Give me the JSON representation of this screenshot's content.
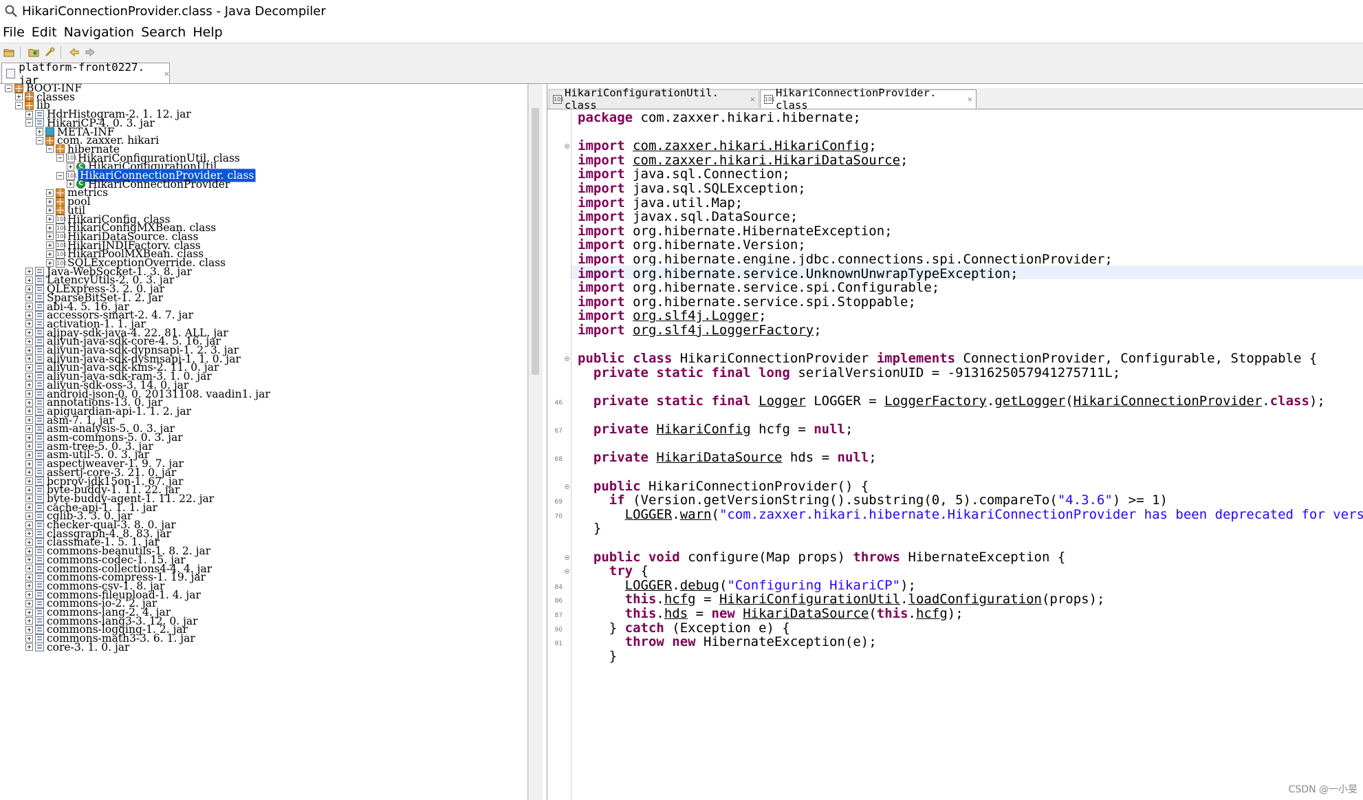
{
  "window": {
    "title": "HikariConnectionProvider.class - Java Decompiler"
  },
  "menu": [
    "File",
    "Edit",
    "Navigation",
    "Search",
    "Help"
  ],
  "toolbar": {
    "icons": [
      "open-folder-icon",
      "open-type-icon",
      "search-icon",
      "back-arrow-icon",
      "forward-arrow-icon"
    ]
  },
  "outer_tab": {
    "label": "platform-front0227. jar"
  },
  "tree": [
    {
      "label": "BOOT-INF",
      "icon": "pkg",
      "exp": "minus",
      "level": 0
    },
    {
      "label": "classes",
      "icon": "pkg",
      "exp": "plus",
      "level": 1
    },
    {
      "label": "lib",
      "icon": "pkg",
      "exp": "minus",
      "level": 1
    },
    {
      "label": "HdrHistogram-2. 1. 12. jar",
      "icon": "jar",
      "exp": "plus",
      "level": 2
    },
    {
      "label": "HikariCP-4. 0. 3. jar",
      "icon": "jar",
      "exp": "minus",
      "level": 2
    },
    {
      "label": "META-INF",
      "icon": "meta",
      "exp": "plus",
      "level": 3
    },
    {
      "label": "com. zaxxer. hikari",
      "icon": "pkg",
      "exp": "minus",
      "level": 3
    },
    {
      "label": "hibernate",
      "icon": "pkg",
      "exp": "minus",
      "level": 4
    },
    {
      "label": "HikariConfigurationUtil. class",
      "icon": "cls",
      "exp": "minus",
      "level": 5
    },
    {
      "label": "HikariConfigurationUtil",
      "icon": "tcls",
      "exp": "plus",
      "level": 6
    },
    {
      "label": "HikariConnectionProvider. class",
      "icon": "cls",
      "exp": "minus",
      "level": 5,
      "selected": true
    },
    {
      "label": "HikariConnectionProvider",
      "icon": "tcls",
      "exp": "plus",
      "level": 6
    },
    {
      "label": "metrics",
      "icon": "pkg",
      "exp": "plus",
      "level": 4
    },
    {
      "label": "pool",
      "icon": "pkg",
      "exp": "plus",
      "level": 4
    },
    {
      "label": "util",
      "icon": "pkg",
      "exp": "plus",
      "level": 4
    },
    {
      "label": "HikariConfig. class",
      "icon": "cls",
      "exp": "plus",
      "level": 4
    },
    {
      "label": "HikariConfigMXBean. class",
      "icon": "cls",
      "exp": "plus",
      "level": 4
    },
    {
      "label": "HikariDataSource. class",
      "icon": "cls",
      "exp": "plus",
      "level": 4
    },
    {
      "label": "HikariJNDIFactory. class",
      "icon": "cls",
      "exp": "plus",
      "level": 4
    },
    {
      "label": "HikariPoolMXBean. class",
      "icon": "cls",
      "exp": "plus",
      "level": 4
    },
    {
      "label": "SQLExceptionOverride. class",
      "icon": "cls",
      "exp": "plus",
      "level": 4
    },
    {
      "label": "Java-WebSocket-1. 3. 8. jar",
      "icon": "jar",
      "exp": "plus",
      "level": 2
    },
    {
      "label": "LatencyUtils-2. 0. 3. jar",
      "icon": "jar",
      "exp": "plus",
      "level": 2
    },
    {
      "label": "QLExpress-3. 2. 0. jar",
      "icon": "jar",
      "exp": "plus",
      "level": 2
    },
    {
      "label": "SparseBitSet-1. 2. jar",
      "icon": "jar",
      "exp": "plus",
      "level": 2
    },
    {
      "label": "abi-4. 5. 16. jar",
      "icon": "jar",
      "exp": "plus",
      "level": 2
    },
    {
      "label": "accessors-smart-2. 4. 7. jar",
      "icon": "jar",
      "exp": "plus",
      "level": 2
    },
    {
      "label": "activation-1. 1. jar",
      "icon": "jar",
      "exp": "plus",
      "level": 2
    },
    {
      "label": "alipay-sdk-java-4. 22. 81. ALL. jar",
      "icon": "jar",
      "exp": "plus",
      "level": 2
    },
    {
      "label": "aliyun-java-sdk-core-4. 5. 16. jar",
      "icon": "jar",
      "exp": "plus",
      "level": 2
    },
    {
      "label": "aliyun-java-sdk-dypnsapi-1. 2. 3. jar",
      "icon": "jar",
      "exp": "plus",
      "level": 2
    },
    {
      "label": "aliyun-java-sdk-dysmsapi-1. 1. 0. jar",
      "icon": "jar",
      "exp": "plus",
      "level": 2
    },
    {
      "label": "aliyun-java-sdk-kms-2. 11. 0. jar",
      "icon": "jar",
      "exp": "plus",
      "level": 2
    },
    {
      "label": "aliyun-java-sdk-ram-3. 1. 0. jar",
      "icon": "jar",
      "exp": "plus",
      "level": 2
    },
    {
      "label": "aliyun-sdk-oss-3. 14. 0. jar",
      "icon": "jar",
      "exp": "plus",
      "level": 2
    },
    {
      "label": "android-json-0. 0. 20131108. vaadin1. jar",
      "icon": "jar",
      "exp": "plus",
      "level": 2
    },
    {
      "label": "annotations-13. 0. jar",
      "icon": "jar",
      "exp": "plus",
      "level": 2
    },
    {
      "label": "apiguardian-api-1. 1. 2. jar",
      "icon": "jar",
      "exp": "plus",
      "level": 2
    },
    {
      "label": "asm-7. 1. jar",
      "icon": "jar",
      "exp": "plus",
      "level": 2
    },
    {
      "label": "asm-analysis-5. 0. 3. jar",
      "icon": "jar",
      "exp": "plus",
      "level": 2
    },
    {
      "label": "asm-commons-5. 0. 3. jar",
      "icon": "jar",
      "exp": "plus",
      "level": 2
    },
    {
      "label": "asm-tree-5. 0. 3. jar",
      "icon": "jar",
      "exp": "plus",
      "level": 2
    },
    {
      "label": "asm-util-5. 0. 3. jar",
      "icon": "jar",
      "exp": "plus",
      "level": 2
    },
    {
      "label": "aspectjweaver-1. 9. 7. jar",
      "icon": "jar",
      "exp": "plus",
      "level": 2
    },
    {
      "label": "assertj-core-3. 21. 0. jar",
      "icon": "jar",
      "exp": "plus",
      "level": 2
    },
    {
      "label": "bcprov-jdk15on-1. 67. jar",
      "icon": "jar",
      "exp": "plus",
      "level": 2
    },
    {
      "label": "byte-buddy-1. 11. 22. jar",
      "icon": "jar",
      "exp": "plus",
      "level": 2
    },
    {
      "label": "byte-buddy-agent-1. 11. 22. jar",
      "icon": "jar",
      "exp": "plus",
      "level": 2
    },
    {
      "label": "cache-api-1. 1. 1. jar",
      "icon": "jar",
      "exp": "plus",
      "level": 2
    },
    {
      "label": "cglib-3. 3. 0. jar",
      "icon": "jar",
      "exp": "plus",
      "level": 2
    },
    {
      "label": "checker-qual-3. 8. 0. jar",
      "icon": "jar",
      "exp": "plus",
      "level": 2
    },
    {
      "label": "classgraph-4. 8. 83. jar",
      "icon": "jar",
      "exp": "plus",
      "level": 2
    },
    {
      "label": "classmate-1. 5. 1. jar",
      "icon": "jar",
      "exp": "plus",
      "level": 2
    },
    {
      "label": "commons-beanutils-1. 8. 2. jar",
      "icon": "jar",
      "exp": "plus",
      "level": 2
    },
    {
      "label": "commons-codec-1. 15. jar",
      "icon": "jar",
      "exp": "plus",
      "level": 2
    },
    {
      "label": "commons-collections4-4. 4. jar",
      "icon": "jar",
      "exp": "plus",
      "level": 2
    },
    {
      "label": "commons-compress-1. 19. jar",
      "icon": "jar",
      "exp": "plus",
      "level": 2
    },
    {
      "label": "commons-csv-1. 8. jar",
      "icon": "jar",
      "exp": "plus",
      "level": 2
    },
    {
      "label": "commons-fileupload-1. 4. jar",
      "icon": "jar",
      "exp": "plus",
      "level": 2
    },
    {
      "label": "commons-io-2. 2. jar",
      "icon": "jar",
      "exp": "plus",
      "level": 2
    },
    {
      "label": "commons-lang-2. 4. jar",
      "icon": "jar",
      "exp": "plus",
      "level": 2
    },
    {
      "label": "commons-lang3-3. 12. 0. jar",
      "icon": "jar",
      "exp": "plus",
      "level": 2
    },
    {
      "label": "commons-logging-1. 2. jar",
      "icon": "jar",
      "exp": "plus",
      "level": 2
    },
    {
      "label": "commons-math3-3. 6. 1. jar",
      "icon": "jar",
      "exp": "plus",
      "level": 2
    },
    {
      "label": "core-3. 1. 0. jar",
      "icon": "jar",
      "exp": "plus",
      "level": 2
    }
  ],
  "editor_tabs": [
    {
      "label": "HikariConfigurationUtil. class",
      "active": false
    },
    {
      "label": "HikariConnectionProvider. class",
      "active": true
    }
  ],
  "code_lines": [
    {
      "num": "",
      "fold": false,
      "hl": false,
      "segs": [
        {
          "t": "package",
          "c": "kw"
        },
        {
          "t": " com.zaxxer.hikari.hibernate;"
        }
      ]
    },
    {
      "num": "",
      "fold": false,
      "hl": false,
      "segs": []
    },
    {
      "num": "",
      "fold": true,
      "hl": false,
      "segs": [
        {
          "t": "import",
          "c": "kw"
        },
        {
          "t": " "
        },
        {
          "t": "com.zaxxer.hikari.HikariConfig",
          "c": "u"
        },
        {
          "t": ";"
        }
      ]
    },
    {
      "num": "",
      "fold": false,
      "hl": false,
      "segs": [
        {
          "t": "import",
          "c": "kw"
        },
        {
          "t": " "
        },
        {
          "t": "com.zaxxer.hikari.HikariDataSource",
          "c": "u"
        },
        {
          "t": ";"
        }
      ]
    },
    {
      "num": "",
      "fold": false,
      "hl": false,
      "segs": [
        {
          "t": "import",
          "c": "kw"
        },
        {
          "t": " java.sql.Connection;"
        }
      ]
    },
    {
      "num": "",
      "fold": false,
      "hl": false,
      "segs": [
        {
          "t": "import",
          "c": "kw"
        },
        {
          "t": " java.sql.SQLException;"
        }
      ]
    },
    {
      "num": "",
      "fold": false,
      "hl": false,
      "segs": [
        {
          "t": "import",
          "c": "kw"
        },
        {
          "t": " java.util.Map;"
        }
      ]
    },
    {
      "num": "",
      "fold": false,
      "hl": false,
      "segs": [
        {
          "t": "import",
          "c": "kw"
        },
        {
          "t": " javax.sql.DataSource;"
        }
      ]
    },
    {
      "num": "",
      "fold": false,
      "hl": false,
      "segs": [
        {
          "t": "import",
          "c": "kw"
        },
        {
          "t": " org.hibernate.HibernateException;"
        }
      ]
    },
    {
      "num": "",
      "fold": false,
      "hl": false,
      "segs": [
        {
          "t": "import",
          "c": "kw"
        },
        {
          "t": " org.hibernate.Version;"
        }
      ]
    },
    {
      "num": "",
      "fold": false,
      "hl": false,
      "segs": [
        {
          "t": "import",
          "c": "kw"
        },
        {
          "t": " org.hibernate.engine.jdbc.connections.spi.ConnectionProvider;"
        }
      ]
    },
    {
      "num": "",
      "fold": false,
      "hl": true,
      "segs": [
        {
          "t": "import",
          "c": "kw"
        },
        {
          "t": " org.hibernate.service.UnknownUnwrapTypeException;"
        }
      ]
    },
    {
      "num": "",
      "fold": false,
      "hl": false,
      "segs": [
        {
          "t": "import",
          "c": "kw"
        },
        {
          "t": " org.hibernate.service.spi.Configurable;"
        }
      ]
    },
    {
      "num": "",
      "fold": false,
      "hl": false,
      "segs": [
        {
          "t": "import",
          "c": "kw"
        },
        {
          "t": " org.hibernate.service.spi.Stoppable;"
        }
      ]
    },
    {
      "num": "",
      "fold": false,
      "hl": false,
      "segs": [
        {
          "t": "import",
          "c": "kw"
        },
        {
          "t": " "
        },
        {
          "t": "org.slf4j.Logger",
          "c": "u"
        },
        {
          "t": ";"
        }
      ]
    },
    {
      "num": "",
      "fold": false,
      "hl": false,
      "segs": [
        {
          "t": "import",
          "c": "kw"
        },
        {
          "t": " "
        },
        {
          "t": "org.slf4j.LoggerFactory",
          "c": "u"
        },
        {
          "t": ";"
        }
      ]
    },
    {
      "num": "",
      "fold": false,
      "hl": false,
      "segs": []
    },
    {
      "num": "",
      "fold": true,
      "hl": false,
      "segs": [
        {
          "t": "public class",
          "c": "kw"
        },
        {
          "t": " HikariConnectionProvider "
        },
        {
          "t": "implements",
          "c": "kw"
        },
        {
          "t": " ConnectionProvider, Configurable, Stoppable {"
        }
      ]
    },
    {
      "num": "",
      "fold": false,
      "hl": false,
      "segs": [
        {
          "t": "  "
        },
        {
          "t": "private static final long",
          "c": "kw"
        },
        {
          "t": " serialVersionUID = -9131625057941275711L;"
        }
      ]
    },
    {
      "num": "",
      "fold": false,
      "hl": false,
      "segs": []
    },
    {
      "num": "46",
      "fold": false,
      "hl": false,
      "segs": [
        {
          "t": "  "
        },
        {
          "t": "private static final",
          "c": "kw"
        },
        {
          "t": " "
        },
        {
          "t": "Logger",
          "c": "u"
        },
        {
          "t": " LOGGER = "
        },
        {
          "t": "LoggerFactory",
          "c": "u"
        },
        {
          "t": "."
        },
        {
          "t": "getLogger",
          "c": "u"
        },
        {
          "t": "("
        },
        {
          "t": "HikariConnectionProvider",
          "c": "u"
        },
        {
          "t": "."
        },
        {
          "t": "class",
          "c": "kw"
        },
        {
          "t": ");"
        }
      ]
    },
    {
      "num": "",
      "fold": false,
      "hl": false,
      "segs": []
    },
    {
      "num": "67",
      "fold": false,
      "hl": false,
      "segs": [
        {
          "t": "  "
        },
        {
          "t": "private",
          "c": "kw"
        },
        {
          "t": " "
        },
        {
          "t": "HikariConfig",
          "c": "u"
        },
        {
          "t": " hcfg = "
        },
        {
          "t": "null",
          "c": "kw"
        },
        {
          "t": ";"
        }
      ]
    },
    {
      "num": "",
      "fold": false,
      "hl": false,
      "segs": []
    },
    {
      "num": "68",
      "fold": false,
      "hl": false,
      "segs": [
        {
          "t": "  "
        },
        {
          "t": "private",
          "c": "kw"
        },
        {
          "t": " "
        },
        {
          "t": "HikariDataSource",
          "c": "u"
        },
        {
          "t": " hds = "
        },
        {
          "t": "null",
          "c": "kw"
        },
        {
          "t": ";"
        }
      ]
    },
    {
      "num": "",
      "fold": false,
      "hl": false,
      "segs": []
    },
    {
      "num": "",
      "fold": true,
      "hl": false,
      "segs": [
        {
          "t": "  "
        },
        {
          "t": "public",
          "c": "kw"
        },
        {
          "t": " HikariConnectionProvider() {"
        }
      ]
    },
    {
      "num": "69",
      "fold": false,
      "hl": false,
      "segs": [
        {
          "t": "    "
        },
        {
          "t": "if",
          "c": "kw"
        },
        {
          "t": " (Version.getVersionString().substring(0, 5).compareTo("
        },
        {
          "t": "\"4.3.6\"",
          "c": "str"
        },
        {
          "t": ") >= 1)"
        }
      ]
    },
    {
      "num": "70",
      "fold": false,
      "hl": false,
      "segs": [
        {
          "t": "      "
        },
        {
          "t": "LOGGER",
          "c": "u"
        },
        {
          "t": "."
        },
        {
          "t": "warn",
          "c": "u"
        },
        {
          "t": "("
        },
        {
          "t": "\"com.zaxxer.hikari.hibernate.HikariConnectionProvider has been deprecated for versions of Hibernate",
          "c": "str"
        }
      ]
    },
    {
      "num": "",
      "fold": false,
      "hl": false,
      "segs": [
        {
          "t": "  }"
        }
      ]
    },
    {
      "num": "",
      "fold": false,
      "hl": false,
      "segs": []
    },
    {
      "num": "",
      "fold": true,
      "hl": false,
      "segs": [
        {
          "t": "  "
        },
        {
          "t": "public void",
          "c": "kw"
        },
        {
          "t": " configure(Map props) "
        },
        {
          "t": "throws",
          "c": "kw"
        },
        {
          "t": " HibernateException {"
        }
      ]
    },
    {
      "num": "",
      "fold": true,
      "hl": false,
      "segs": [
        {
          "t": "    "
        },
        {
          "t": "try",
          "c": "kw"
        },
        {
          "t": " {"
        }
      ]
    },
    {
      "num": "84",
      "fold": false,
      "hl": false,
      "segs": [
        {
          "t": "      "
        },
        {
          "t": "LOGGER",
          "c": "u"
        },
        {
          "t": "."
        },
        {
          "t": "debug",
          "c": "u"
        },
        {
          "t": "("
        },
        {
          "t": "\"Configuring HikariCP\"",
          "c": "str"
        },
        {
          "t": ");"
        }
      ]
    },
    {
      "num": "86",
      "fold": false,
      "hl": false,
      "segs": [
        {
          "t": "      "
        },
        {
          "t": "this",
          "c": "kw"
        },
        {
          "t": "."
        },
        {
          "t": "hcfg",
          "c": "u"
        },
        {
          "t": " = "
        },
        {
          "t": "HikariConfigurationUtil",
          "c": "u"
        },
        {
          "t": "."
        },
        {
          "t": "loadConfiguration",
          "c": "u"
        },
        {
          "t": "(props);"
        }
      ]
    },
    {
      "num": "87",
      "fold": false,
      "hl": false,
      "segs": [
        {
          "t": "      "
        },
        {
          "t": "this",
          "c": "kw"
        },
        {
          "t": "."
        },
        {
          "t": "hds",
          "c": "u"
        },
        {
          "t": " = "
        },
        {
          "t": "new",
          "c": "kw"
        },
        {
          "t": " "
        },
        {
          "t": "HikariDataSource",
          "c": "u"
        },
        {
          "t": "("
        },
        {
          "t": "this",
          "c": "kw"
        },
        {
          "t": "."
        },
        {
          "t": "hcfg",
          "c": "u"
        },
        {
          "t": ");"
        }
      ]
    },
    {
      "num": "90",
      "fold": false,
      "hl": false,
      "segs": [
        {
          "t": "    } "
        },
        {
          "t": "catch",
          "c": "kw"
        },
        {
          "t": " (Exception e) {"
        }
      ]
    },
    {
      "num": "91",
      "fold": false,
      "hl": false,
      "segs": [
        {
          "t": "      "
        },
        {
          "t": "throw new",
          "c": "kw"
        },
        {
          "t": " HibernateException(e);"
        }
      ]
    },
    {
      "num": "",
      "fold": false,
      "hl": false,
      "segs": [
        {
          "t": "    }"
        }
      ]
    }
  ],
  "watermark": "CSDN @一小旻",
  "colors": {
    "keyword": "#7f0055",
    "string": "#2a00ff",
    "selection": "#0a56d8",
    "current_line": "#e8f2fe"
  }
}
